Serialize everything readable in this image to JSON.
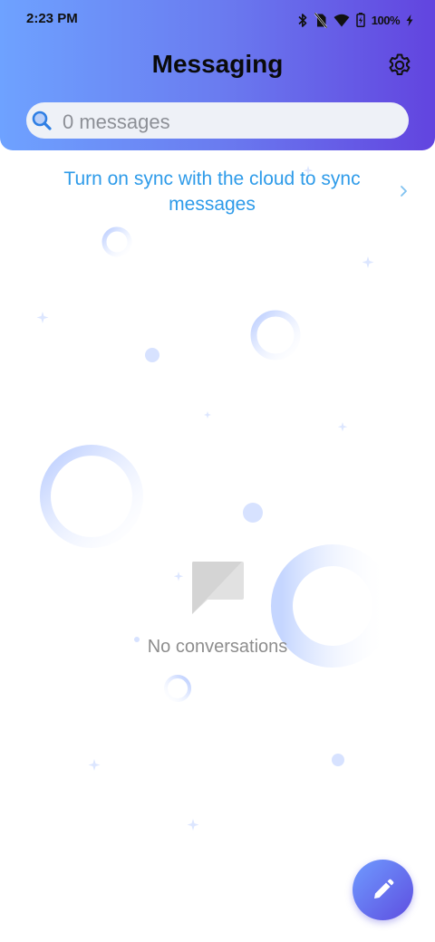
{
  "status_bar": {
    "time": "2:23 PM",
    "battery_text": "100%",
    "icons": [
      "bluetooth-icon",
      "no-sim-icon",
      "wifi-icon",
      "battery-icon",
      "charging-icon"
    ]
  },
  "header": {
    "title": "Messaging",
    "settings_icon": "gear-icon"
  },
  "search": {
    "placeholder": "0 messages",
    "icon": "search-icon"
  },
  "sync_banner": {
    "text": "Turn on sync with the cloud to sync messages",
    "icon": "chevron-right-icon"
  },
  "empty_state": {
    "icon": "message-bubble-icon",
    "text": "No conversations"
  },
  "compose": {
    "icon": "pencil-icon"
  },
  "colors": {
    "header_gradient_start": "#6ea2ff",
    "header_gradient_end": "#6244df",
    "link": "#2e9be9",
    "empty_text": "#8d8d8d",
    "decoration": "#c9d8ff"
  }
}
